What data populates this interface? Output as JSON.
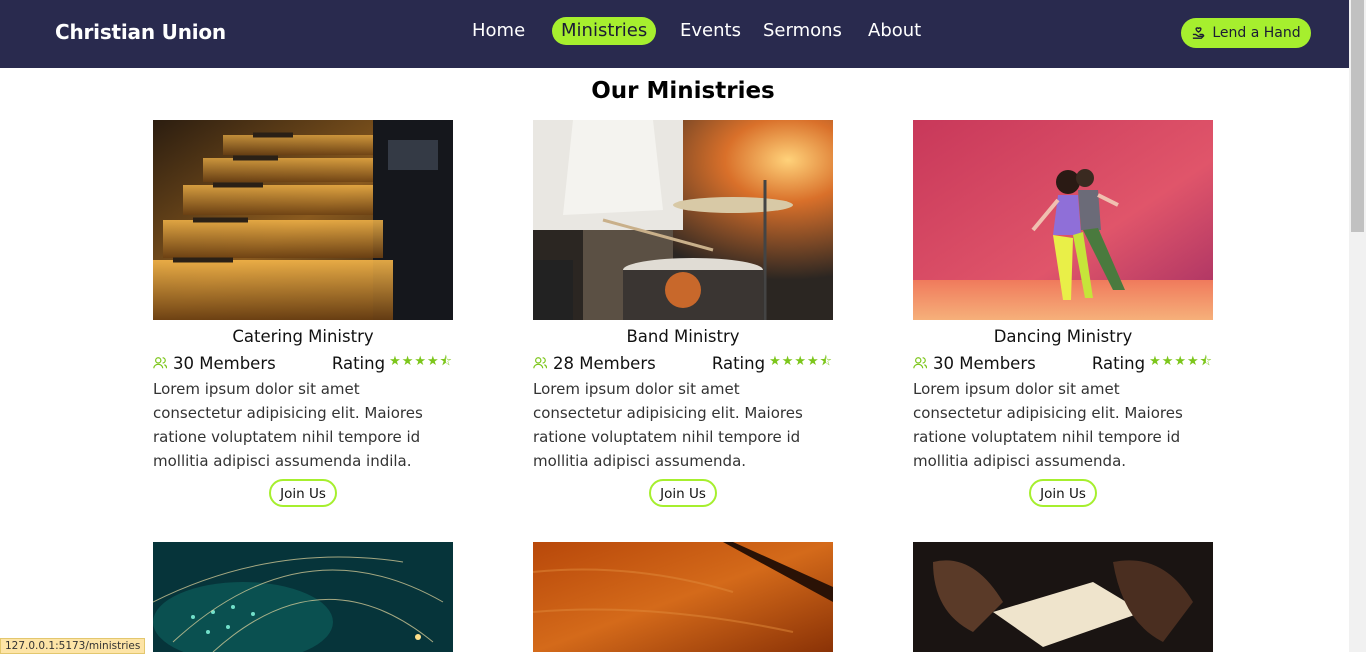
{
  "navbar": {
    "brand": "Christian Union",
    "links": [
      {
        "label": "Home",
        "active": false
      },
      {
        "label": "Ministries",
        "active": true
      },
      {
        "label": "Events",
        "active": false
      },
      {
        "label": "Sermons",
        "active": false
      },
      {
        "label": "About",
        "active": false
      }
    ],
    "cta_label": "Lend a Hand",
    "cta_icon": "hand-heart-icon"
  },
  "page": {
    "title": "Our Ministries"
  },
  "ministries": [
    {
      "title": "Catering Ministry",
      "members": "30 Members",
      "rating_label": "Rating",
      "rating": 4.5,
      "description": "Lorem ipsum dolor sit amet consectetur adipisicing elit. Maiores ratione voluptatem nihil tempore id mollitia adipisci assumenda indila.",
      "button": "Join Us",
      "image": "chafing-dishes-photo"
    },
    {
      "title": "Band Ministry",
      "members": "28 Members",
      "rating_label": "Rating",
      "rating": 4.5,
      "description": "Lorem ipsum dolor sit amet consectetur adipisicing elit. Maiores ratione voluptatem nihil tempore id mollitia adipisci assumenda.",
      "button": "Join Us",
      "image": "drummer-photo"
    },
    {
      "title": "Dancing Ministry",
      "members": "30 Members",
      "rating_label": "Rating",
      "rating": 4.5,
      "description": "Lorem ipsum dolor sit amet consectetur adipisicing elit. Maiores ratione voluptatem nihil tempore id mollitia adipisci assumenda.",
      "button": "Join Us",
      "image": "dancers-photo"
    }
  ],
  "second_row_images": [
    "network-globe-photo",
    "wood-texture-photo",
    "praying-bible-photo"
  ],
  "colors": {
    "nav_bg": "#292a4e",
    "accent": "#a6ef2e",
    "star": "#7cc61b"
  },
  "status_bar": "127.0.0.1:5173/ministries"
}
